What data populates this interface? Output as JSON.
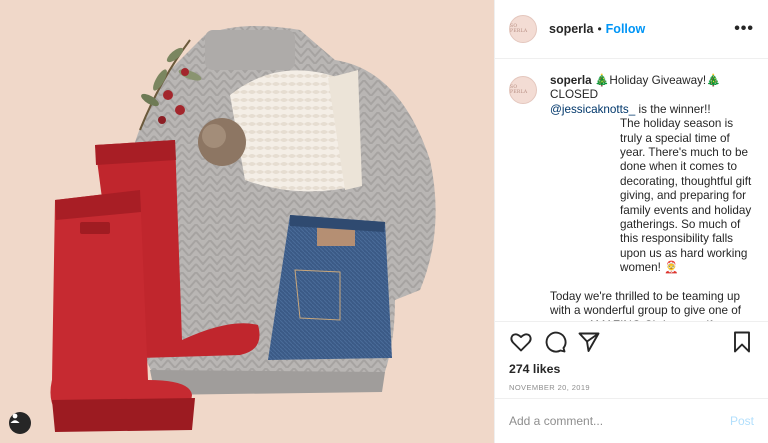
{
  "account": {
    "username": "soperla",
    "avatar_text": "SO PERLA",
    "follow_label": "Follow",
    "separator": "•"
  },
  "header": {
    "more_label": "•••"
  },
  "caption": {
    "username": "soperla",
    "line1": "🎄Holiday Giveaway!🎄",
    "line2": "CLOSED",
    "mention": "@jessicaknotts_",
    "after_mention": " is the winner!!",
    "para1": "The holiday season is truly a special time of year. There's much to be done when it comes to decorating, thoughtful gift giving, and preparing for family events and holiday gatherings. So much of this responsibility falls upon us as hard working women! 🤶",
    "para2": "Today we're thrilled to be teaming up with a wonderful group to give one of you an AMAZING Christmas gift package! This gift is full of goodies"
  },
  "stats": {
    "likes": "274 likes",
    "date": "NOVEMBER 20, 2019"
  },
  "comment": {
    "placeholder": "Add a comment...",
    "post_label": "Post"
  },
  "icons": {
    "like": "heart-icon",
    "comment": "comment-icon",
    "share": "paper-plane-icon",
    "save": "bookmark-icon",
    "tag": "user-tag-icon"
  },
  "colors": {
    "follow": "#0095f6",
    "mention": "#00376b",
    "post_disabled": "#b2dffc",
    "photo_background": "#f0d8c9"
  }
}
